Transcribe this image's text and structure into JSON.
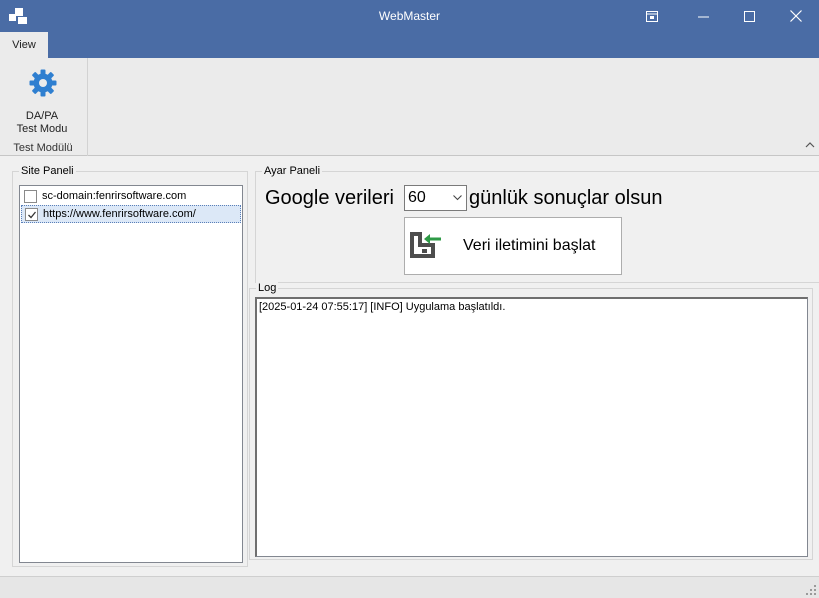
{
  "window": {
    "title": "WebMaster",
    "titlebar_color": "#4a6ca5"
  },
  "ribbon": {
    "tabs": [
      {
        "label": "View",
        "active": true
      }
    ],
    "groups": [
      {
        "label": "Test Modülü",
        "buttons": [
          {
            "line1": "DA/PA",
            "line2": "Test Modu",
            "icon": "gear-icon"
          }
        ]
      }
    ]
  },
  "site_panel": {
    "title": "Site Paneli",
    "items": [
      {
        "label": "sc-domain:fenrirsoftware.com",
        "checked": false,
        "selected": false
      },
      {
        "label": "https://www.fenrirsoftware.com/",
        "checked": true,
        "selected": true
      }
    ]
  },
  "ayar_panel": {
    "title": "Ayar Paneli",
    "prefix": "Google verileri",
    "days_value": "60",
    "suffix": "günlük sonuçlar olsun",
    "start_button": "Veri iletimini başlat",
    "start_icon": "send-data-icon",
    "accent": "#2e9a46"
  },
  "log_panel": {
    "title": "Log",
    "lines": [
      "[2025-01-24 07:55:17] [INFO] Uygulama başlatıldı."
    ]
  }
}
